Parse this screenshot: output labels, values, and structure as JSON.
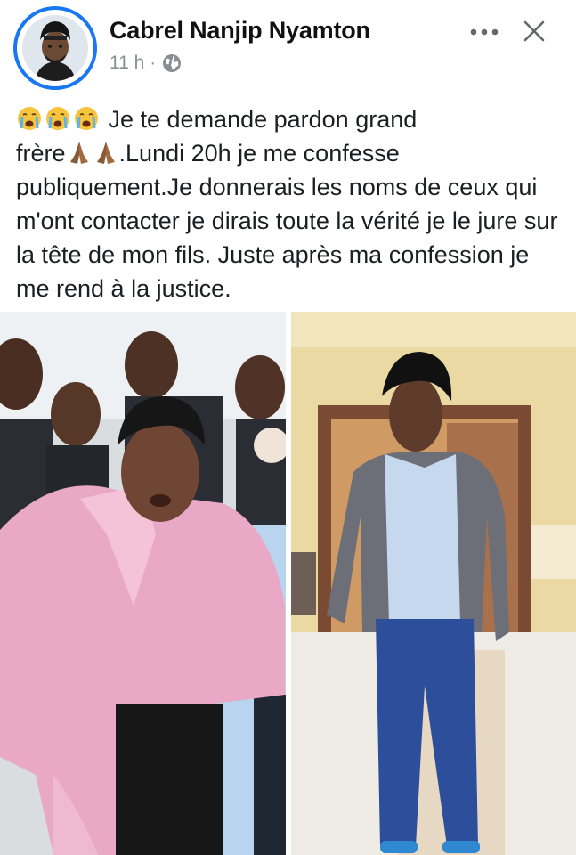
{
  "post": {
    "author": "Cabrel Nanjip Nyamton",
    "time": "11 h",
    "separator": "·",
    "privacy_icon": "globe-icon",
    "more_icon": "more-horizontal-icon",
    "close_icon": "close-icon",
    "text_line_1": " Je te demande pardon grand",
    "text_line_2_a": "frère",
    "text_line_2_b": ".Lundi 20h je me confesse",
    "text_rest": "publiquement.Je  donnerais les noms de ceux qui m'ont contacter je dirais toute la vérité je le jure sur la tête de mon fils. Juste après ma confession je me rend à la justice.",
    "emoji_cry": "crying-face-emoji",
    "emoji_pray": "folded-hands-emoji"
  },
  "colors": {
    "brand_blue": "#1877f2",
    "meta_gray": "#8a8d91",
    "text": "#1c1e21"
  }
}
